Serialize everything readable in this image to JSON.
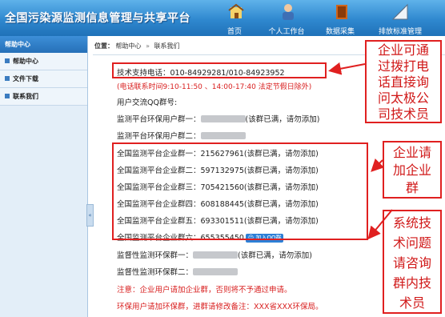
{
  "header": {
    "app_title": "全国污染源监测信息管理与共享平台",
    "nav": [
      {
        "label": "首页",
        "icon": "home-icon"
      },
      {
        "label": "个人工作台",
        "icon": "person-icon"
      },
      {
        "label": "数据采集",
        "icon": "book-icon"
      },
      {
        "label": "排放标准管理",
        "icon": "ruler-icon"
      }
    ]
  },
  "sidebar": {
    "header": "帮助中心",
    "items": [
      {
        "label": "帮助中心"
      },
      {
        "label": "文件下载"
      },
      {
        "label": "联系我们"
      }
    ]
  },
  "breadcrumb": {
    "label": "位置：",
    "items": [
      "帮助中心",
      "联系我们"
    ]
  },
  "content": {
    "phone_label": "技术支持电话：",
    "phone": "010-84929281/010-84923952",
    "hours": "(电话联系时间9:10-11:50 、14:00-17:40 法定节假日除外)",
    "qq_heading": "用户交流QQ群号:",
    "env_groups": [
      {
        "label": "监测平台环保用户群一：",
        "note": "(该群已满，请勿添加)"
      },
      {
        "label": "监测平台环保用户群二：",
        "note": ""
      }
    ],
    "ent_groups": [
      {
        "label": "全国监测平台企业群一：",
        "number": "215627961",
        "note": "(该群已满，请勿添加)"
      },
      {
        "label": "全国监测平台企业群二：",
        "number": "597132975",
        "note": "(该群已满，请勿添加)"
      },
      {
        "label": "全国监测平台企业群三：",
        "number": "705421560",
        "note": "(该群已满，请勿添加)"
      },
      {
        "label": "全国监测平台企业群四：",
        "number": "608188445",
        "note": "(该群已满，请勿添加)"
      },
      {
        "label": "全国监测平台企业群五：",
        "number": "693301511",
        "note": "(该群已满，请勿添加)"
      },
      {
        "label": "全国监测平台企业群六：",
        "number": "655355450",
        "note": ""
      }
    ],
    "join_qq": "加入QQ群",
    "supervision_groups": [
      {
        "label": "监督性监测环保群一：",
        "note": "(该群已满，请勿添加)"
      },
      {
        "label": "监督性监测环保群二：",
        "note": ""
      }
    ],
    "notice1": "注意：企业用户请加企业群，否则将不予通过申请。",
    "notice2": "环保用户请加环保群，进群请修改备注：XXX省XXX环保局。"
  },
  "callouts": {
    "phone_note": [
      "企业可通",
      "过拨打电",
      "话直接询",
      "问太极公",
      "司技术员"
    ],
    "join_note": [
      "企业请",
      "加企业",
      "群"
    ],
    "tech_note": [
      "系统技",
      "术问题",
      "请咨询",
      "群内技",
      "术员"
    ]
  },
  "colors": {
    "banner": "#2f88cf",
    "annotation_red": "#e02020",
    "notice_red": "#d81d1d"
  }
}
